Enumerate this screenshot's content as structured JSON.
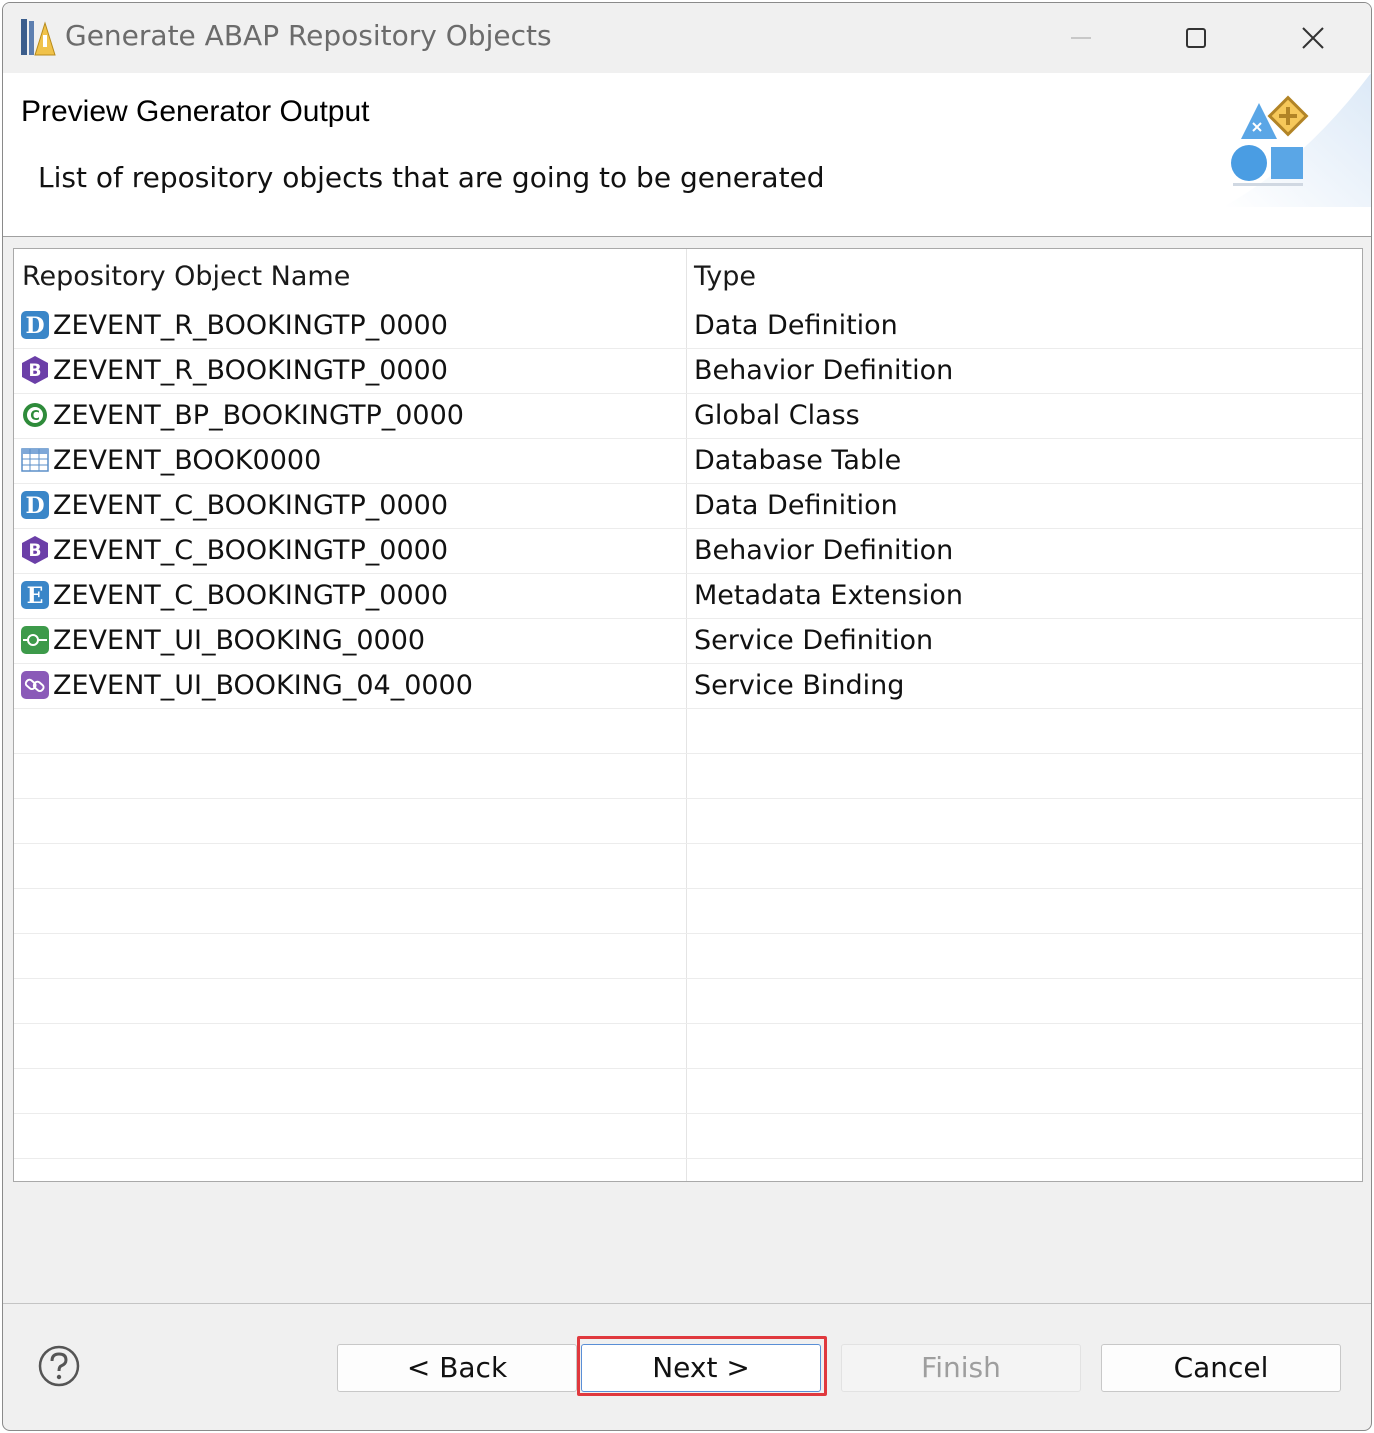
{
  "window": {
    "title": "Generate ABAP Repository Objects"
  },
  "header": {
    "title": "Preview Generator Output",
    "description": "List of repository objects that are going to be generated"
  },
  "table": {
    "columns": {
      "name": "Repository Object Name",
      "type": "Type"
    },
    "rows": [
      {
        "icon": "data-definition-icon",
        "name": "ZEVENT_R_BOOKINGTP_0000",
        "type": "Data Definition"
      },
      {
        "icon": "behavior-definition-icon",
        "name": "ZEVENT_R_BOOKINGTP_0000",
        "type": "Behavior Definition"
      },
      {
        "icon": "global-class-icon",
        "name": "ZEVENT_BP_BOOKINGTP_0000",
        "type": "Global Class"
      },
      {
        "icon": "database-table-icon",
        "name": "ZEVENT_BOOK0000",
        "type": "Database Table"
      },
      {
        "icon": "data-definition-icon",
        "name": "ZEVENT_C_BOOKINGTP_0000",
        "type": "Data Definition"
      },
      {
        "icon": "behavior-definition-icon",
        "name": "ZEVENT_C_BOOKINGTP_0000",
        "type": "Behavior Definition"
      },
      {
        "icon": "metadata-extension-icon",
        "name": "ZEVENT_C_BOOKINGTP_0000",
        "type": "Metadata Extension"
      },
      {
        "icon": "service-definition-icon",
        "name": "ZEVENT_UI_BOOKING_0000",
        "type": "Service Definition"
      },
      {
        "icon": "service-binding-icon",
        "name": "ZEVENT_UI_BOOKING_04_0000",
        "type": "Service Binding"
      }
    ]
  },
  "buttons": {
    "back": "< Back",
    "next": "Next >",
    "finish": "Finish",
    "cancel": "Cancel",
    "finish_enabled": false
  },
  "colors": {
    "highlight": "#e0393e",
    "data_definition": "#3a86c8",
    "behavior_definition": "#6b3fa8",
    "global_class": "#2e8b3a",
    "metadata_extension": "#3a86c8",
    "service_definition": "#3d9a4a",
    "service_binding": "#8a5ab8"
  }
}
